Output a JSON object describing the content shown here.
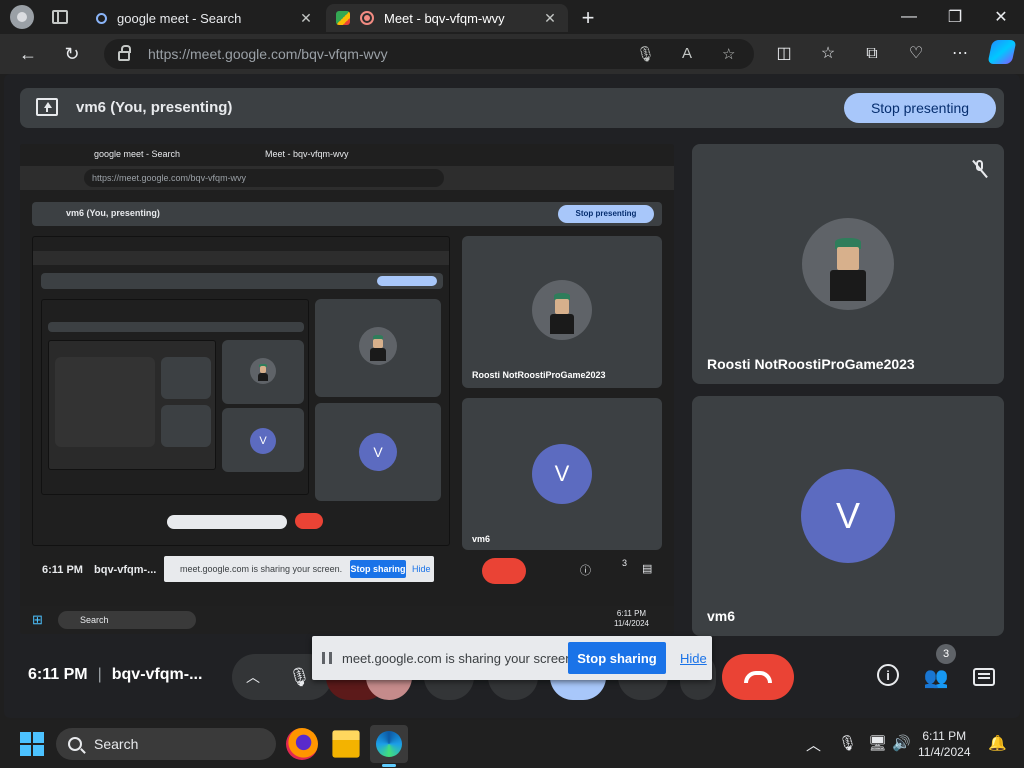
{
  "browser": {
    "tabs": [
      {
        "title": "google meet - Search",
        "active": false
      },
      {
        "title": "Meet - bqv-vfqm-wvy",
        "active": true
      }
    ],
    "url": "https://meet.google.com/bqv-vfqm-wvy"
  },
  "meet": {
    "presenting_label": "vm6 (You, presenting)",
    "stop_presenting_label": "Stop presenting",
    "participants": [
      {
        "name": "Roosti NotRoostiProGame2023",
        "muted": true
      },
      {
        "name": "vm6",
        "initial": "V"
      }
    ],
    "time": "6:11 PM",
    "meeting_code": "bqv-vfqm-...",
    "sharing_banner": {
      "message": "meet.google.com is sharing your screen.",
      "stop_label": "Stop sharing",
      "hide_label": "Hide"
    },
    "people_count": "3"
  },
  "nested": {
    "url": "https://meet.google.com/bqv-vfqm-wvy",
    "tab1": "google meet - Search",
    "tab2": "Meet - bqv-vfqm-wvy",
    "time": "6:11 PM",
    "code": "bqv-vfqm-...",
    "banner": "meet.google.com is sharing your screen.",
    "search": "Search",
    "date": "11/4/2024"
  },
  "taskbar": {
    "search_placeholder": "Search",
    "time": "6:11 PM",
    "date": "11/4/2024"
  },
  "colors": {
    "accent_blue": "#a8c7fa",
    "end_call_red": "#ea4335",
    "avatar_purple": "#5c6bc0",
    "tile_bg": "#3c4043"
  }
}
